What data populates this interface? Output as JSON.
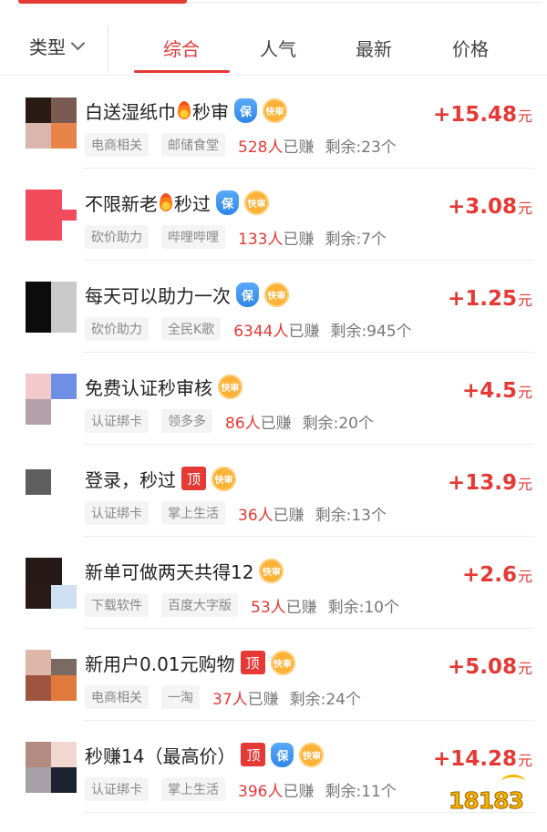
{
  "filter": {
    "type_label": "类型"
  },
  "tabs": [
    {
      "label": "综合",
      "active": true
    },
    {
      "label": "人气",
      "active": false
    },
    {
      "label": "最新",
      "active": false
    },
    {
      "label": "价格",
      "active": false
    }
  ],
  "tasks": [
    {
      "title": "白送湿纸巾",
      "title_tail": "秒审",
      "fire": true,
      "bao": true,
      "ding": false,
      "kuai": true,
      "kuai_label": "快审",
      "tags": [
        "电商相关",
        "邮储食堂"
      ],
      "earned_count": "528人",
      "earned_suffix": "已赚",
      "remaining": "剩余:23个",
      "price": "+15.48",
      "unit": "元"
    },
    {
      "title": "不限新老",
      "title_tail": "秒过",
      "fire": true,
      "bao": true,
      "ding": false,
      "kuai": true,
      "kuai_label": "快审",
      "tags": [
        "砍价助力",
        "哔哩哔哩"
      ],
      "earned_count": "133人",
      "earned_suffix": "已赚",
      "remaining": "剩余:7个",
      "price": "+3.08",
      "unit": "元"
    },
    {
      "title": "每天可以助力一次",
      "title_tail": "",
      "fire": false,
      "bao": true,
      "ding": false,
      "kuai": true,
      "kuai_label": "快审",
      "tags": [
        "砍价助力",
        "全民K歌"
      ],
      "earned_count": "6344人",
      "earned_suffix": "已赚",
      "remaining": "剩余:945个",
      "price": "+1.25",
      "unit": "元"
    },
    {
      "title": "免费认证秒审核",
      "title_tail": "",
      "fire": false,
      "bao": false,
      "ding": false,
      "kuai": true,
      "kuai_label": "快审",
      "tags": [
        "认证绑卡",
        "领多多"
      ],
      "earned_count": "86人",
      "earned_suffix": "已赚",
      "remaining": "剩余:20个",
      "price": "+4.5",
      "unit": "元"
    },
    {
      "title": "登录，秒过",
      "title_tail": "",
      "fire": false,
      "bao": false,
      "ding": true,
      "ding_label": "顶",
      "kuai": true,
      "kuai_label": "快审",
      "tags": [
        "认证绑卡",
        "掌上生活"
      ],
      "earned_count": "36人",
      "earned_suffix": "已赚",
      "remaining": "剩余:13个",
      "price": "+13.9",
      "unit": "元"
    },
    {
      "title": "新单可做两天共得12",
      "title_tail": "",
      "fire": false,
      "bao": false,
      "ding": false,
      "kuai": true,
      "kuai_label": "快审",
      "tags": [
        "下载软件",
        "百度大字版"
      ],
      "earned_count": "53人",
      "earned_suffix": "已赚",
      "remaining": "剩余:10个",
      "price": "+2.6",
      "unit": "元"
    },
    {
      "title": "新用户0.01元购物",
      "title_tail": "",
      "fire": false,
      "bao": false,
      "ding": true,
      "ding_label": "顶",
      "kuai": true,
      "kuai_label": "快审",
      "tags": [
        "电商相关",
        "一淘"
      ],
      "earned_count": "37人",
      "earned_suffix": "已赚",
      "remaining": "剩余:24个",
      "price": "+5.08",
      "unit": "元"
    },
    {
      "title": "秒赚14（最高价）",
      "title_tail": "",
      "fire": false,
      "bao": true,
      "ding": true,
      "ding_label": "顶",
      "kuai": true,
      "kuai_label": "快审",
      "tags": [
        "认证绑卡",
        "掌上生活"
      ],
      "earned_count": "396人",
      "earned_suffix": "已赚",
      "remaining": "剩余:11个",
      "price": "+14.28",
      "unit": "元"
    }
  ],
  "colors": {
    "accent": "#e53935",
    "bao": "#2f86e8",
    "kuai": "#f58b12"
  },
  "watermark": {
    "text": "18183"
  }
}
